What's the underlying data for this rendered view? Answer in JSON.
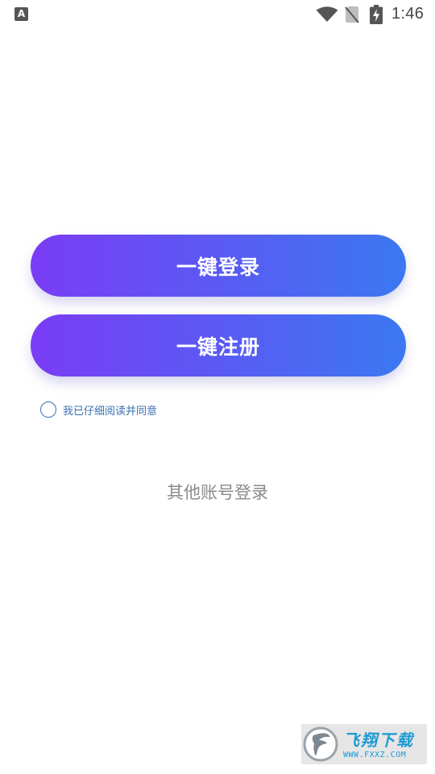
{
  "status_bar": {
    "app_icon_letter": "A",
    "time": "1:46",
    "icons": [
      "wifi-icon",
      "no-sim-icon",
      "battery-charging-icon"
    ]
  },
  "buttons": {
    "login_label": "一键登录",
    "register_label": "一键注册"
  },
  "agreement": {
    "checked": false,
    "text": "我已仔细阅读并同意"
  },
  "other_login_label": "其他账号登录",
  "watermark": {
    "title": "飞翔下载",
    "url": "WWW.FXXZ.COM"
  },
  "colors": {
    "button_gradient_start": "#7a3cf5",
    "button_gradient_end": "#3b78f1",
    "agreement_text": "#3a6fb0",
    "other_login_text": "#8a8a8a"
  }
}
